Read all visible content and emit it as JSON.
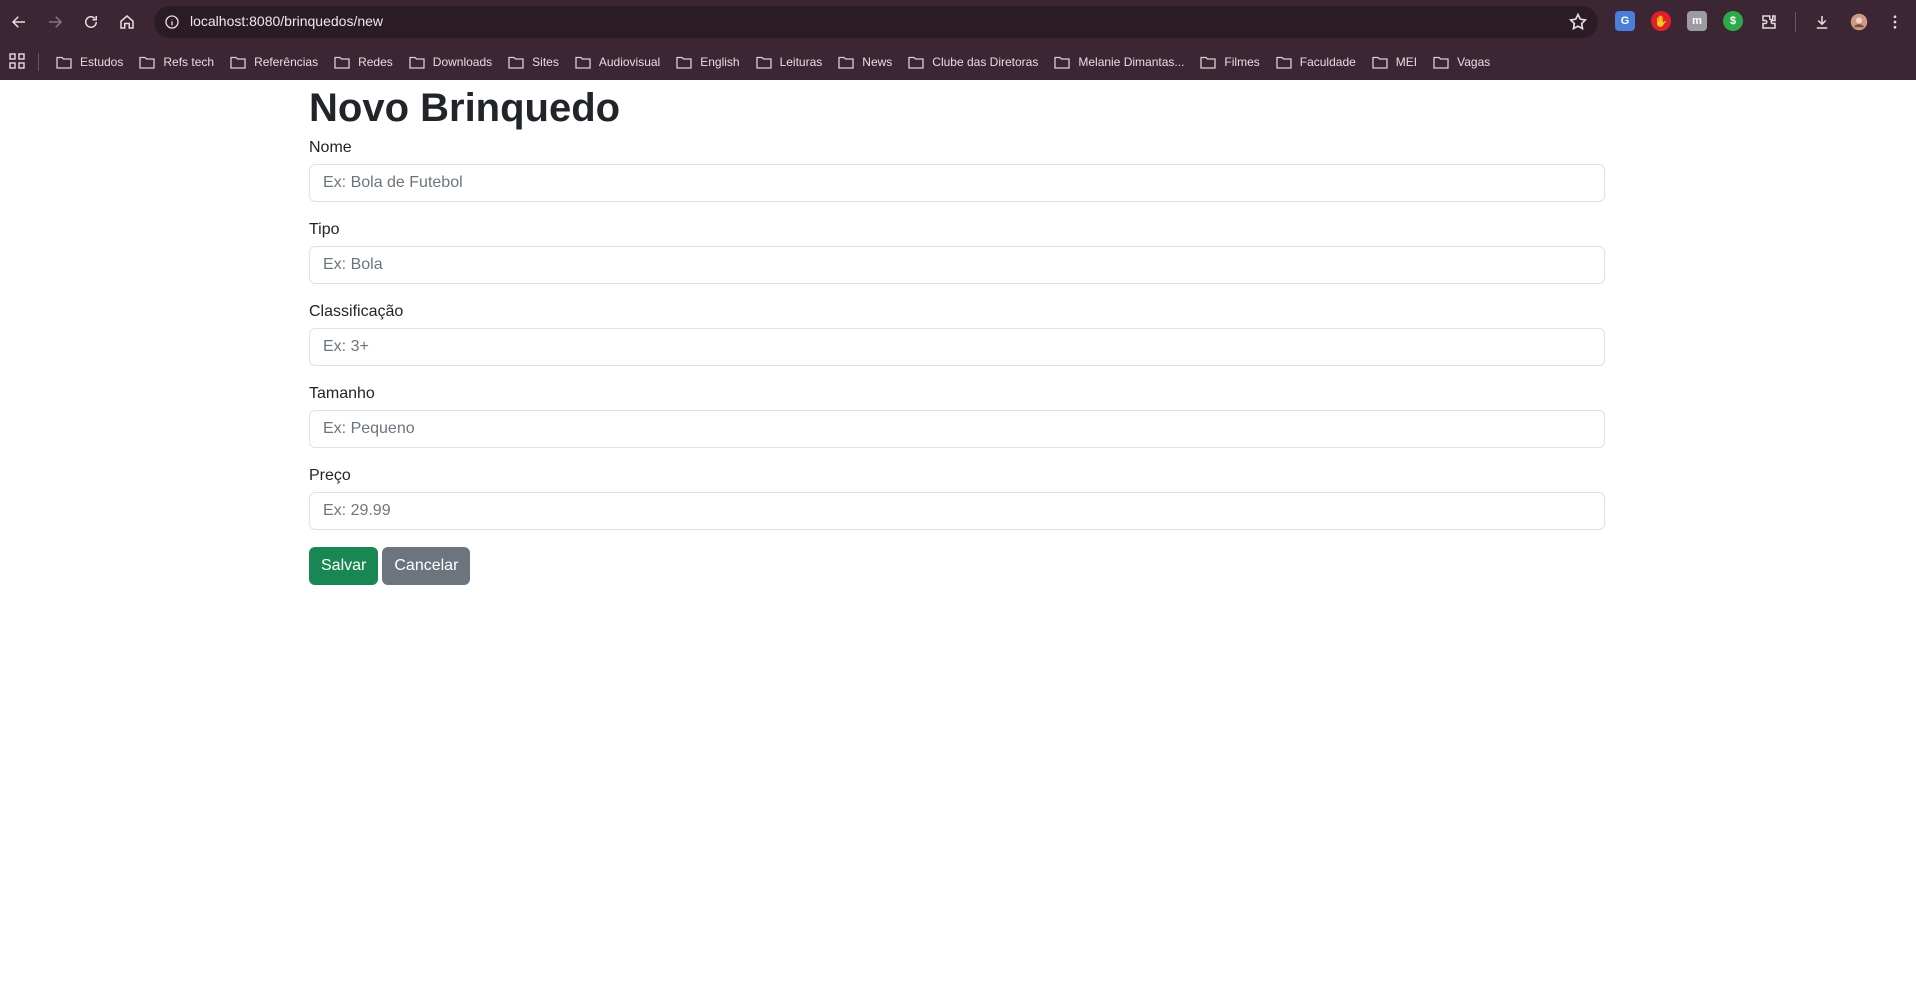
{
  "browser": {
    "url": "localhost:8080/brinquedos/new",
    "extensions": [
      {
        "name": "translate-extension-icon",
        "glyph": "G",
        "color": "#4a7fd8"
      },
      {
        "name": "adblock-extension-icon",
        "glyph": "✋",
        "color": "#e2202a"
      },
      {
        "name": "m-extension-icon",
        "glyph": "m",
        "color": "#9b9ba1"
      },
      {
        "name": "dollar-extension-icon",
        "glyph": "$",
        "color": "#2ea84a"
      }
    ],
    "bookmarks": [
      "Estudos",
      "Refs tech",
      "Referências",
      "Redes",
      "Downloads",
      "Sites",
      "Audiovisual",
      "English",
      "Leituras",
      "News",
      "Clube das Diretoras",
      "Melanie Dimantas...",
      "Filmes",
      "Faculdade",
      "MEI",
      "Vagas"
    ]
  },
  "form": {
    "title": "Novo Brinquedo",
    "fields": [
      {
        "label": "Nome",
        "placeholder": "Ex: Bola de Futebol"
      },
      {
        "label": "Tipo",
        "placeholder": "Ex: Bola"
      },
      {
        "label": "Classificação",
        "placeholder": "Ex: 3+"
      },
      {
        "label": "Tamanho",
        "placeholder": "Ex: Pequeno"
      },
      {
        "label": "Preço",
        "placeholder": "Ex: 29.99"
      }
    ],
    "save_label": "Salvar",
    "cancel_label": "Cancelar"
  }
}
